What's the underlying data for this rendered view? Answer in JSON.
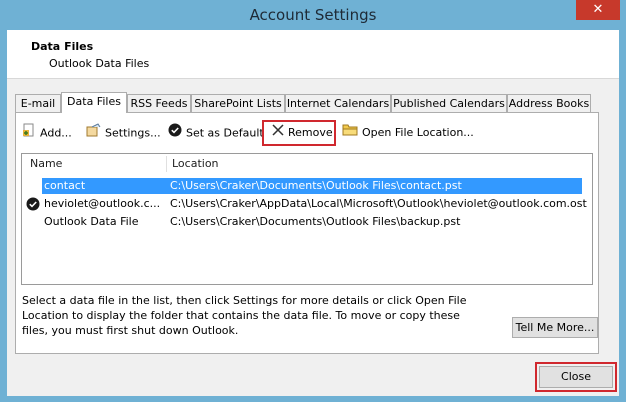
{
  "window": {
    "title": "Account Settings",
    "close_glyph": "✕"
  },
  "header": {
    "title": "Data Files",
    "subtitle": "Outlook Data Files"
  },
  "tabs": [
    {
      "label": "E-mail"
    },
    {
      "label": "Data Files",
      "active": true
    },
    {
      "label": "RSS Feeds"
    },
    {
      "label": "SharePoint Lists"
    },
    {
      "label": "Internet Calendars"
    },
    {
      "label": "Published Calendars"
    },
    {
      "label": "Address Books"
    }
  ],
  "toolbar": {
    "add": "Add...",
    "settings": "Settings...",
    "set_default": "Set as Default",
    "remove": "Remove",
    "open_location": "Open File Location..."
  },
  "list": {
    "columns": {
      "name": "Name",
      "location": "Location"
    },
    "rows": [
      {
        "name": "contact",
        "location": "C:\\Users\\Craker\\Documents\\Outlook Files\\contact.pst",
        "selected": true,
        "default": false
      },
      {
        "name": "heviolet@outlook.c...",
        "location": "C:\\Users\\Craker\\AppData\\Local\\Microsoft\\Outlook\\heviolet@outlook.com.ost",
        "selected": false,
        "default": true
      },
      {
        "name": "Outlook Data File",
        "location": "C:\\Users\\Craker\\Documents\\Outlook Files\\backup.pst",
        "selected": false,
        "default": false
      }
    ]
  },
  "description": "Select a data file in the list, then click Settings for more details or click Open File Location to display the folder that contains the data file. To move or copy these files, you must first shut down Outlook.",
  "buttons": {
    "tell_me_more": "Tell Me More...",
    "close": "Close"
  },
  "colors": {
    "titlebar": "#6fb1d4",
    "selection": "#3399ff",
    "highlight_box": "#d0282e",
    "close_button": "#c7392b"
  }
}
